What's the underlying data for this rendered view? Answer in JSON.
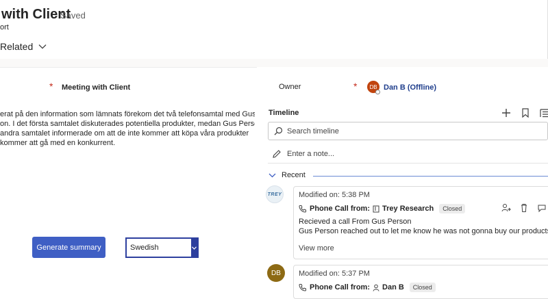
{
  "header": {
    "title": "with Client",
    "saved_status": "- Saved",
    "subtitle": "ort",
    "related_tab": "Related"
  },
  "form": {
    "subject_required_marker": "*",
    "subject_value": "Meeting with Client",
    "description_lines": [
      "erat på den information som lämnats förekom det två telefonsamtal med Gus",
      "on. I det första samtalet diskuterades potentiella produkter, medan Gus Person",
      " andra samtalet informerade om att de inte kommer att köpa våra produkter",
      "kommer att gå med en konkurrent."
    ],
    "generate_button": "Generate summary",
    "language_selected": "Swedish"
  },
  "owner": {
    "label": "Owner",
    "required_marker": "*",
    "avatar_initials": "DB",
    "name": "Dan B (Offline)"
  },
  "timeline": {
    "title": "Timeline",
    "search_placeholder": "Search timeline",
    "note_placeholder": "Enter a note...",
    "recent_label": "Recent",
    "items": [
      {
        "modified": "Modified on: 5:38 PM",
        "type_label": "Phone Call from:",
        "party": "Trey Research",
        "status": "Closed",
        "line1": "Recieved a call From Gus Person",
        "line2": "Gus Person reached out to let me know he was not gonna buy our products a",
        "view_more": "View more",
        "avatar_logo": "TREY"
      },
      {
        "modified": "Modified on: 5:37 PM",
        "type_label": "Phone Call from:",
        "party": "Dan B",
        "status": "Closed",
        "avatar_initials": "DB"
      }
    ]
  },
  "colors": {
    "accent_button": "#3f5fc4",
    "owner_link": "#1f3e8c",
    "required": "#c42b1c",
    "owner_avatar": "#c1440e",
    "contact_avatar": "#8d6a14"
  },
  "icons": {
    "related_chevron": "chevron-down-icon",
    "select_chevron": "chevron-down-icon",
    "timeline_add": "plus-icon",
    "timeline_bookmark": "bookmark-icon",
    "timeline_list": "list-icon",
    "search": "search-icon",
    "note": "pencil-icon",
    "recent_toggle": "chevron-down-icon",
    "phone": "phone-icon",
    "account": "account-icon",
    "contact": "person-icon",
    "assign": "assign-icon",
    "delete": "delete-icon",
    "more": "more-icon"
  }
}
